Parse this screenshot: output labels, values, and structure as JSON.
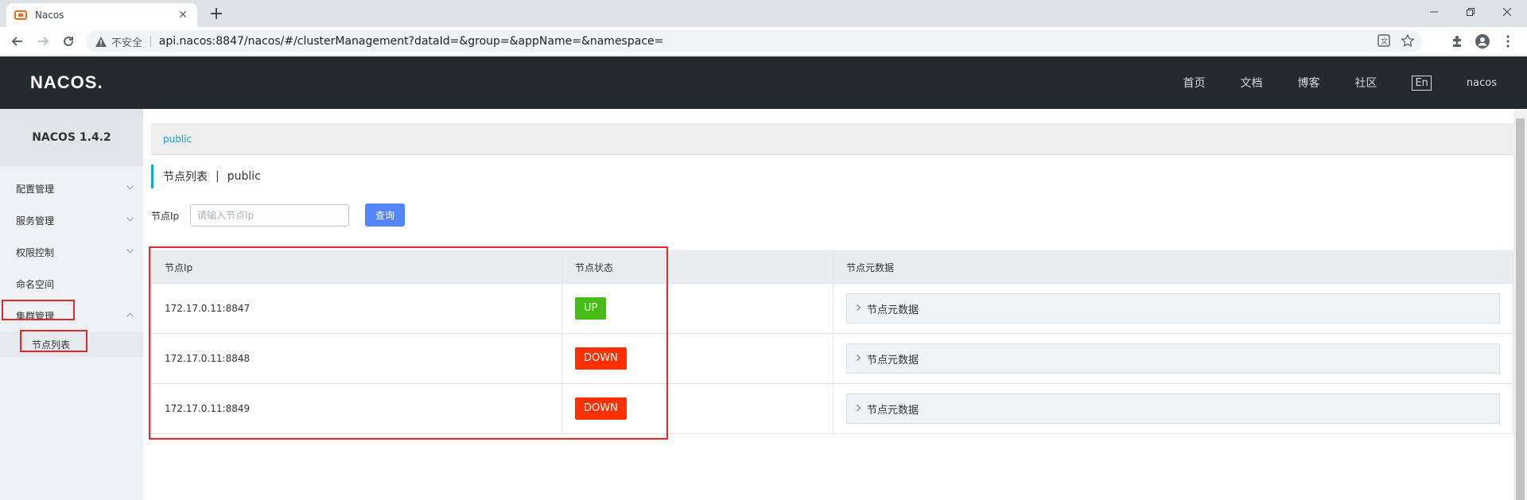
{
  "browser": {
    "tab_title": "Nacos",
    "tab_close": "✕",
    "new_tab": "+",
    "security_label": "不安全",
    "url": "api.nacos:8847/nacos/#/clusterManagement?dataId=&group=&appName=&namespace="
  },
  "header": {
    "logo": "NACOS.",
    "nav": [
      "首页",
      "文档",
      "博客",
      "社区"
    ],
    "lang": "En",
    "user": "nacos"
  },
  "sidebar": {
    "title": "NACOS 1.4.2",
    "items": [
      {
        "label": "配置管理",
        "expanded": false
      },
      {
        "label": "服务管理",
        "expanded": false
      },
      {
        "label": "权限控制",
        "expanded": false
      },
      {
        "label": "命名空间"
      },
      {
        "label": "集群管理",
        "expanded": true
      }
    ],
    "sub_items": [
      "节点列表"
    ]
  },
  "main": {
    "breadcrumb": "public",
    "title": "节点列表",
    "title_sep": "|",
    "title_ns": "public",
    "search": {
      "label": "节点Ip",
      "placeholder": "请输入节点Ip",
      "button": "查询"
    },
    "table": {
      "columns": [
        "节点Ip",
        "节点状态",
        "节点元数据"
      ],
      "rows": [
        {
          "ip": "172.17.0.11:8847",
          "status": "UP",
          "meta": "节点元数据"
        },
        {
          "ip": "172.17.0.11:8848",
          "status": "DOWN",
          "meta": "节点元数据"
        },
        {
          "ip": "172.17.0.11:8849",
          "status": "DOWN",
          "meta": "节点元数据"
        }
      ]
    }
  },
  "colors": {
    "header_bg": "#252a2f",
    "accent": "#1a9fd8",
    "primary_button": "#5584ff",
    "status_up": "#46bc15",
    "status_down": "#ff3000",
    "annotation_red": "#e5262b"
  }
}
